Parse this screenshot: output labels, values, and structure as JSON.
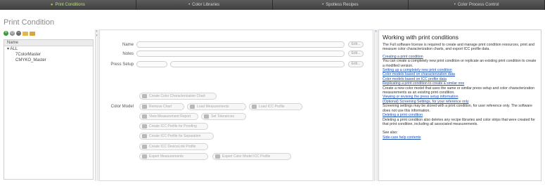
{
  "tabs": [
    {
      "label": "Print Conditions",
      "active": true
    },
    {
      "label": "Color Libraries",
      "active": false
    },
    {
      "label": "Spotless Recipes",
      "active": false
    },
    {
      "label": "Color Process Control",
      "active": false
    }
  ],
  "page_title": "Print Condition",
  "toolbar": {
    "icons": [
      "add-icon",
      "copy-icon",
      "delete-icon",
      "open-folder-icon",
      "export-icon"
    ]
  },
  "tree": {
    "header": "Name",
    "root": "ALL",
    "children": [
      "7ColorMaster",
      "CMYKO_Master"
    ]
  },
  "form": {
    "name_label": "Name",
    "notes_label": "Notes",
    "press_setup_label": "Press Setup",
    "color_model_label": "Color Model",
    "edit_label": "Edit...",
    "buttons": {
      "create_char_chart": "Create Color Characterization Chart",
      "remove_chart": "Remove Chart",
      "load_measurements": "Load Measurements",
      "load_icc_profile": "Load ICC Profile",
      "view_measurement_report": "View Measurement Report",
      "set_tolerances": "Set Tolerances",
      "create_icc_proofing": "Create ICC Profile for Proofing",
      "create_icc_separation": "Create ICC Profile for Separation",
      "create_icc_devicelink": "Create ICC DeviceLink Profile",
      "export_measurements": "Export Measurements",
      "export_color_model": "Export Color Model ICC Profile"
    }
  },
  "help": {
    "title": "Working with print conditions",
    "intro": "The Full software license is required to create and manage print condition resources, print and measure color characterization charts, and export ICC profile data.",
    "link_create": "Creating a print condition",
    "text_create": "You can create a completely new print condition or replicate an existing print condition to create a modified version.",
    "link_new": "Setting up a completely new print condition",
    "link_models_char": "Color models based on characterization data",
    "link_models_icc": "Color models based on ICC profile data",
    "link_replicate": "Replicating a print condition to create a similar one",
    "text_replicate": "Create a new color model that uses the same or similar press setup and color characterization measurements as an existing print condition.",
    "link_viewing": "Viewing or revising the press setup information",
    "link_screening": "(Optional) Screening Settings, for your reference only",
    "text_screening": "Screening settings may be stored with a print condition, for user reference only. The software does not use this information.",
    "link_deleting": "Deleting a print condition",
    "text_deleting": "Deleting a print condition also deletes any recipe libraries and color strips that were created for that print condition, including all associated measurements.",
    "see_also": "See also:",
    "link_sidecare": "Side-care help contents"
  }
}
